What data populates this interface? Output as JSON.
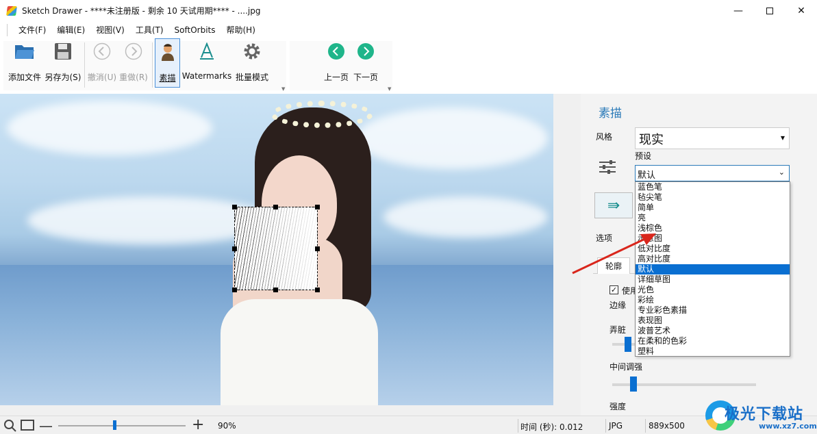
{
  "window": {
    "title": "Sketch Drawer - ****未注册版 - 剩余 10 天试用期**** - ....jpg",
    "minimize": "—",
    "close": "✕"
  },
  "menu": [
    "文件(F)",
    "编辑(E)",
    "视图(V)",
    "工具(T)",
    "SoftOrbits",
    "帮助(H)"
  ],
  "toolbar": {
    "add_file": "添加文件",
    "save_as": "另存为(S)",
    "undo": "撤消(U)",
    "redo": "重做(R)",
    "sketch": "素描",
    "watermarks": "Watermarks",
    "batch": "批量模式",
    "prev": "上一页",
    "next": "下一页"
  },
  "panel": {
    "title": "素描",
    "style_label": "风格",
    "style_value": "现实",
    "preset_label": "预设",
    "preset_value": "默认",
    "options_label": "选项",
    "tab_outline": "轮廓",
    "use_label": "使用",
    "edge_label": "边缘",
    "dirty_label": "弄脏",
    "mid_label": "中间调强",
    "strength_label": "强度"
  },
  "preset_options": [
    "蓝色笔",
    "毡尖笔",
    "简单",
    "亮",
    "浅棕色",
    "示意图",
    "低对比度",
    "高对比度",
    "默认",
    "详细草图",
    "光色",
    "彩绘",
    "专业彩色素描",
    "表现图",
    "波普艺术",
    "在柔和的色彩",
    "塑料"
  ],
  "preset_selected_index": 8,
  "status": {
    "zoom": "90%",
    "time": "时间 (秒): 0.012",
    "format": "JPG",
    "size": "889x500"
  },
  "watermark": {
    "name": "极光下载站",
    "url": "www.xz7.com"
  },
  "colors": {
    "accent": "#0a6fd1",
    "panel_title": "#2a7ab8",
    "arrow": "#d9261c"
  }
}
